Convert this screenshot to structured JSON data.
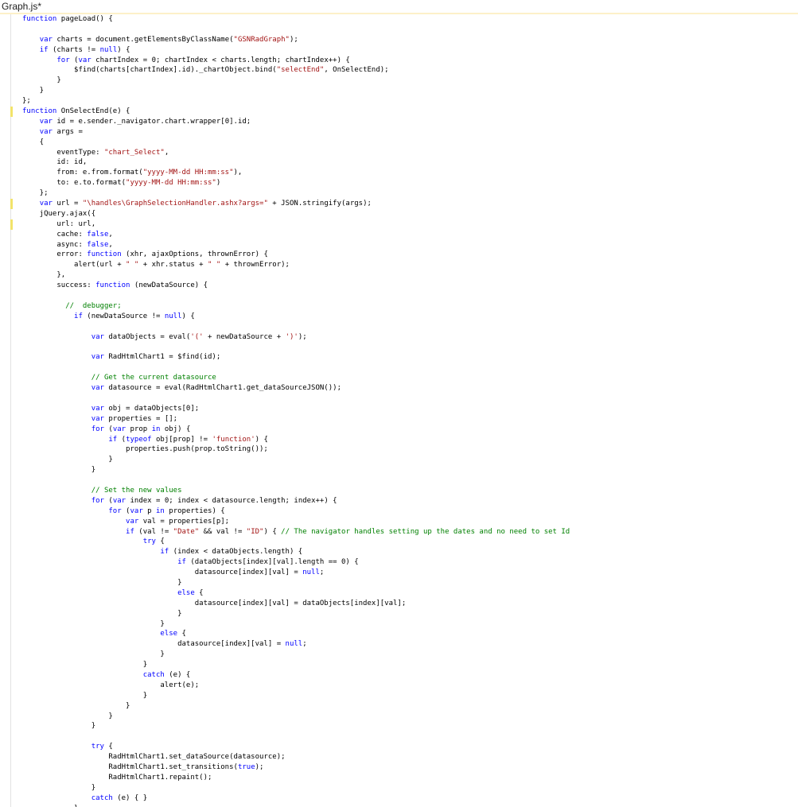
{
  "editor": {
    "tab_title": "Graph.js*",
    "changed_lines": [
      9,
      18,
      20
    ],
    "lines": [
      [
        [
          "kw",
          "function"
        ],
        [
          "pl",
          " pageLoad() {"
        ]
      ],
      [],
      [
        [
          "pl",
          "    "
        ],
        [
          "kw",
          "var"
        ],
        [
          "pl",
          " charts = document.getElementsByClassName("
        ],
        [
          "str",
          "\"GSNRadGraph\""
        ],
        [
          "pl",
          ");"
        ]
      ],
      [
        [
          "pl",
          "    "
        ],
        [
          "kw",
          "if"
        ],
        [
          "pl",
          " (charts != "
        ],
        [
          "kw",
          "null"
        ],
        [
          "pl",
          ") {"
        ]
      ],
      [
        [
          "pl",
          "        "
        ],
        [
          "kw",
          "for"
        ],
        [
          "pl",
          " ("
        ],
        [
          "kw",
          "var"
        ],
        [
          "pl",
          " chartIndex = 0; chartIndex < charts.length; chartIndex++) {"
        ]
      ],
      [
        [
          "pl",
          "            $find(charts[chartIndex].id)._chartObject.bind("
        ],
        [
          "str",
          "\"selectEnd\""
        ],
        [
          "pl",
          ", OnSelectEnd);"
        ]
      ],
      [
        [
          "pl",
          "        }"
        ]
      ],
      [
        [
          "pl",
          "    }"
        ]
      ],
      [
        [
          "pl",
          "};"
        ]
      ],
      [
        [
          "kw",
          "function"
        ],
        [
          "pl",
          " OnSelectEnd(e) {"
        ]
      ],
      [
        [
          "pl",
          "    "
        ],
        [
          "kw",
          "var"
        ],
        [
          "pl",
          " id = e.sender._navigator.chart.wrapper[0].id;"
        ]
      ],
      [
        [
          "pl",
          "    "
        ],
        [
          "kw",
          "var"
        ],
        [
          "pl",
          " args ="
        ]
      ],
      [
        [
          "pl",
          "    {"
        ]
      ],
      [
        [
          "pl",
          "        eventType: "
        ],
        [
          "str",
          "\"chart_Select\""
        ],
        [
          "pl",
          ","
        ]
      ],
      [
        [
          "pl",
          "        id: id,"
        ]
      ],
      [
        [
          "pl",
          "        from: e.from.format("
        ],
        [
          "str",
          "\"yyyy-MM-dd HH:mm:ss\""
        ],
        [
          "pl",
          "),"
        ]
      ],
      [
        [
          "pl",
          "        to: e.to.format("
        ],
        [
          "str",
          "\"yyyy-MM-dd HH:mm:ss\""
        ],
        [
          "pl",
          ")"
        ]
      ],
      [
        [
          "pl",
          "    };"
        ]
      ],
      [
        [
          "pl",
          "    "
        ],
        [
          "kw",
          "var"
        ],
        [
          "pl",
          " url = "
        ],
        [
          "str",
          "\"\\handles\\GraphSelectionHandler.ashx?args=\""
        ],
        [
          "pl",
          " + JSON.stringify(args);"
        ]
      ],
      [
        [
          "pl",
          "    jQuery.ajax({"
        ]
      ],
      [
        [
          "pl",
          "        url: url,"
        ]
      ],
      [
        [
          "pl",
          "        cache: "
        ],
        [
          "kw",
          "false"
        ],
        [
          "pl",
          ","
        ]
      ],
      [
        [
          "pl",
          "        async: "
        ],
        [
          "kw",
          "false"
        ],
        [
          "pl",
          ","
        ]
      ],
      [
        [
          "pl",
          "        error: "
        ],
        [
          "kw",
          "function"
        ],
        [
          "pl",
          " (xhr, ajaxOptions, thrownError) {"
        ]
      ],
      [
        [
          "pl",
          "            alert(url + "
        ],
        [
          "str",
          "\" \""
        ],
        [
          "pl",
          " + xhr.status + "
        ],
        [
          "str",
          "\" \""
        ],
        [
          "pl",
          " + thrownError);"
        ]
      ],
      [
        [
          "pl",
          "        },"
        ]
      ],
      [
        [
          "pl",
          "        success: "
        ],
        [
          "kw",
          "function"
        ],
        [
          "pl",
          " (newDataSource) {"
        ]
      ],
      [],
      [
        [
          "pl",
          "          "
        ],
        [
          "cm",
          "//  debugger;"
        ]
      ],
      [
        [
          "pl",
          "            "
        ],
        [
          "kw",
          "if"
        ],
        [
          "pl",
          " (newDataSource != "
        ],
        [
          "kw",
          "null"
        ],
        [
          "pl",
          ") {"
        ]
      ],
      [],
      [
        [
          "pl",
          "                "
        ],
        [
          "kw",
          "var"
        ],
        [
          "pl",
          " dataObjects = eval("
        ],
        [
          "str",
          "'('"
        ],
        [
          "pl",
          " + newDataSource + "
        ],
        [
          "str",
          "')'"
        ],
        [
          "pl",
          ");"
        ]
      ],
      [],
      [
        [
          "pl",
          "                "
        ],
        [
          "kw",
          "var"
        ],
        [
          "pl",
          " RadHtmlChart1 = $find(id);"
        ]
      ],
      [],
      [
        [
          "pl",
          "                "
        ],
        [
          "cm",
          "// Get the current datasource"
        ]
      ],
      [
        [
          "pl",
          "                "
        ],
        [
          "kw",
          "var"
        ],
        [
          "pl",
          " datasource = eval(RadHtmlChart1.get_dataSourceJSON());"
        ]
      ],
      [],
      [
        [
          "pl",
          "                "
        ],
        [
          "kw",
          "var"
        ],
        [
          "pl",
          " obj = dataObjects[0];"
        ]
      ],
      [
        [
          "pl",
          "                "
        ],
        [
          "kw",
          "var"
        ],
        [
          "pl",
          " properties = [];"
        ]
      ],
      [
        [
          "pl",
          "                "
        ],
        [
          "kw",
          "for"
        ],
        [
          "pl",
          " ("
        ],
        [
          "kw",
          "var"
        ],
        [
          "pl",
          " prop "
        ],
        [
          "kw",
          "in"
        ],
        [
          "pl",
          " obj) {"
        ]
      ],
      [
        [
          "pl",
          "                    "
        ],
        [
          "kw",
          "if"
        ],
        [
          "pl",
          " ("
        ],
        [
          "kw",
          "typeof"
        ],
        [
          "pl",
          " obj[prop] != "
        ],
        [
          "str",
          "'function'"
        ],
        [
          "pl",
          ") {"
        ]
      ],
      [
        [
          "pl",
          "                        properties.push(prop.toString());"
        ]
      ],
      [
        [
          "pl",
          "                    }"
        ]
      ],
      [
        [
          "pl",
          "                }"
        ]
      ],
      [],
      [
        [
          "pl",
          "                "
        ],
        [
          "cm",
          "// Set the new values"
        ]
      ],
      [
        [
          "pl",
          "                "
        ],
        [
          "kw",
          "for"
        ],
        [
          "pl",
          " ("
        ],
        [
          "kw",
          "var"
        ],
        [
          "pl",
          " index = 0; index < datasource.length; index++) {"
        ]
      ],
      [
        [
          "pl",
          "                    "
        ],
        [
          "kw",
          "for"
        ],
        [
          "pl",
          " ("
        ],
        [
          "kw",
          "var"
        ],
        [
          "pl",
          " p "
        ],
        [
          "kw",
          "in"
        ],
        [
          "pl",
          " properties) {"
        ]
      ],
      [
        [
          "pl",
          "                        "
        ],
        [
          "kw",
          "var"
        ],
        [
          "pl",
          " val = properties[p];"
        ]
      ],
      [
        [
          "pl",
          "                        "
        ],
        [
          "kw",
          "if"
        ],
        [
          "pl",
          " (val != "
        ],
        [
          "str",
          "\"Date\""
        ],
        [
          "pl",
          " && val != "
        ],
        [
          "str",
          "\"ID\""
        ],
        [
          "pl",
          ") { "
        ],
        [
          "cm",
          "// The navigator handles setting up the dates and no need to set Id"
        ]
      ],
      [
        [
          "pl",
          "                            "
        ],
        [
          "kw",
          "try"
        ],
        [
          "pl",
          " {"
        ]
      ],
      [
        [
          "pl",
          "                                "
        ],
        [
          "kw",
          "if"
        ],
        [
          "pl",
          " (index < dataObjects.length) {"
        ]
      ],
      [
        [
          "pl",
          "                                    "
        ],
        [
          "kw",
          "if"
        ],
        [
          "pl",
          " (dataObjects[index][val].length == 0) {"
        ]
      ],
      [
        [
          "pl",
          "                                        datasource[index][val] = "
        ],
        [
          "kw",
          "null"
        ],
        [
          "pl",
          ";"
        ]
      ],
      [
        [
          "pl",
          "                                    }"
        ]
      ],
      [
        [
          "pl",
          "                                    "
        ],
        [
          "kw",
          "else"
        ],
        [
          "pl",
          " {"
        ]
      ],
      [
        [
          "pl",
          "                                        datasource[index][val] = dataObjects[index][val];"
        ]
      ],
      [
        [
          "pl",
          "                                    }"
        ]
      ],
      [
        [
          "pl",
          "                                }"
        ]
      ],
      [
        [
          "pl",
          "                                "
        ],
        [
          "kw",
          "else"
        ],
        [
          "pl",
          " {"
        ]
      ],
      [
        [
          "pl",
          "                                    datasource[index][val] = "
        ],
        [
          "kw",
          "null"
        ],
        [
          "pl",
          ";"
        ]
      ],
      [
        [
          "pl",
          "                                }"
        ]
      ],
      [
        [
          "pl",
          "                            }"
        ]
      ],
      [
        [
          "pl",
          "                            "
        ],
        [
          "kw",
          "catch"
        ],
        [
          "pl",
          " (e) {"
        ]
      ],
      [
        [
          "pl",
          "                                alert(e);"
        ]
      ],
      [
        [
          "pl",
          "                            }"
        ]
      ],
      [
        [
          "pl",
          "                        }"
        ]
      ],
      [
        [
          "pl",
          "                    }"
        ]
      ],
      [
        [
          "pl",
          "                }"
        ]
      ],
      [],
      [
        [
          "pl",
          "                "
        ],
        [
          "kw",
          "try"
        ],
        [
          "pl",
          " {"
        ]
      ],
      [
        [
          "pl",
          "                    RadHtmlChart1.set_dataSource(datasource);"
        ]
      ],
      [
        [
          "pl",
          "                    RadHtmlChart1.set_transitions("
        ],
        [
          "kw",
          "true"
        ],
        [
          "pl",
          ");"
        ]
      ],
      [
        [
          "pl",
          "                    RadHtmlChart1.repaint();"
        ]
      ],
      [
        [
          "pl",
          "                }"
        ]
      ],
      [
        [
          "pl",
          "                "
        ],
        [
          "kw",
          "catch"
        ],
        [
          "pl",
          " (e) { }"
        ]
      ],
      [
        [
          "pl",
          "            }"
        ]
      ],
      [
        [
          "pl",
          "        }"
        ]
      ]
    ]
  }
}
